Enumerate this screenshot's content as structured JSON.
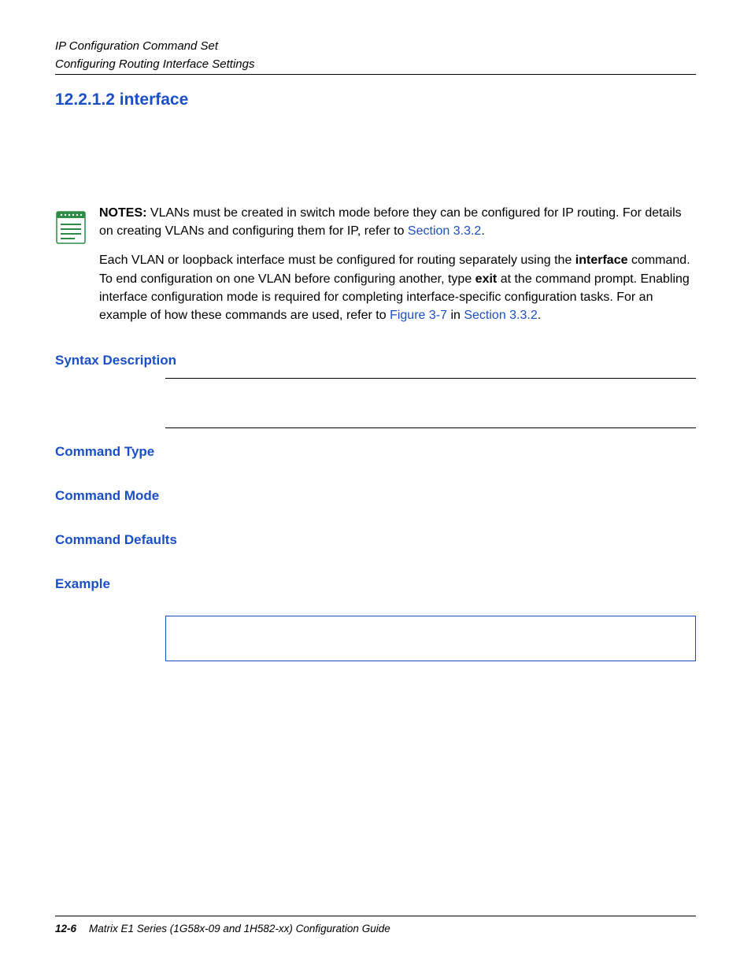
{
  "header": {
    "line1": "IP Configuration Command Set",
    "line2": "Configuring Routing Interface Settings"
  },
  "title": "12.2.1.2  interface",
  "notes_label": "NOTES:",
  "note1_part1": "  VLANs must be created in switch mode before they can be configured for IP routing. For details on creating VLANs and configuring them for IP, refer to ",
  "note1_link1": "Section 3.3.2",
  "note1_part2": ".",
  "note2_part1": "Each VLAN or loopback interface must be configured for routing separately using the ",
  "note2_bold1": "interface",
  "note2_part2": " command. To end configuration on one VLAN before configuring another, type ",
  "note2_bold2": "exit",
  "note2_part3": " at the command prompt. Enabling interface configuration mode is required for completing interface-specific configuration tasks. For an example of how these commands are used, refer to ",
  "note2_link1": "Figure 3-7",
  "note2_part4": " in ",
  "note2_link2": "Section 3.3.2",
  "note2_part5": ".",
  "headings": {
    "syntax": "Syntax Description",
    "cmd_type": "Command Type",
    "cmd_mode": "Command Mode",
    "cmd_defaults": "Command Defaults",
    "example": "Example"
  },
  "footer": {
    "page": "12-6",
    "guide": "Matrix E1 Series (1G58x-09 and 1H582-xx) Configuration Guide"
  }
}
